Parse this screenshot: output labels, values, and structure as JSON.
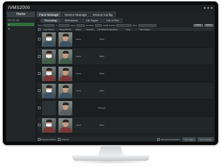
{
  "app_title": "iVMS2000",
  "titlebar": {
    "user_info": ""
  },
  "left_panel": {
    "home_tab": "Home",
    "tree_items": [
      "",
      ""
    ]
  },
  "module_tabs": [
    "Face Manage",
    "Device Manage",
    "Device Config"
  ],
  "sub_tabs": [
    "Recording",
    "Attendance",
    "List Import",
    "List of Res"
  ],
  "filter": {
    "from_label": "From",
    "from_value": "",
    "to_label": "To",
    "to_value": "",
    "name_label": "Name",
    "name_value": "",
    "mode_label": "Ice Mode",
    "mode_value": "",
    "number_label": "Card# Number",
    "number_value": "",
    "more_label": "More",
    "search_button": "Search",
    "export_button": "Export"
  },
  "table": {
    "columns": [
      "",
      "Live Picture",
      "Snap Picture",
      "Name",
      "Number",
      "List Mode",
      "Temperature",
      "Time",
      "Information"
    ],
    "rows": [
      {
        "thumb_style": "",
        "name": "Guest",
        "number": "",
        "mode": "White",
        "temp": "",
        "time": "",
        "info": ""
      },
      {
        "thumb_style": "green",
        "name": "Guest",
        "number": "",
        "mode": "White",
        "temp": "",
        "time": "",
        "info": ""
      },
      {
        "thumb_style": "red",
        "name": "Guest",
        "number": "",
        "mode": "White",
        "temp": "",
        "time": "",
        "info": ""
      },
      {
        "thumb_style": "",
        "name": "Guest",
        "number": "",
        "mode": "White",
        "temp": "",
        "time": "",
        "info": ""
      },
      {
        "thumb_style": "gray",
        "name": "",
        "number": "",
        "mode": "Stranger",
        "temp": "",
        "time": "",
        "info": ""
      },
      {
        "thumb_style": "red",
        "name": "Guest",
        "number": "",
        "mode": "White",
        "temp": "",
        "time": "",
        "info": ""
      }
    ]
  },
  "statusbar": {
    "left_items": [
      "Snapshot Picture",
      "Progress"
    ],
    "count_label": "",
    "right_items": [
      "Abnormal Temperature",
      "Live Stage",
      "Normal Stage"
    ]
  }
}
